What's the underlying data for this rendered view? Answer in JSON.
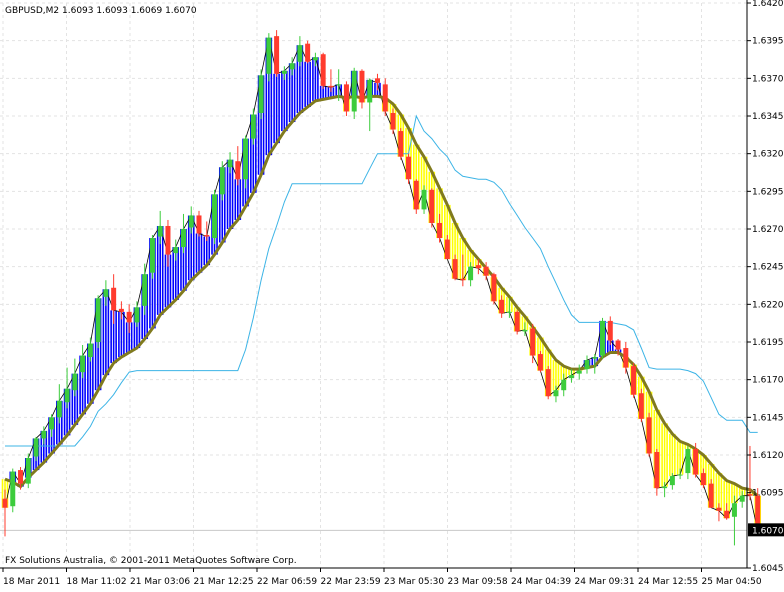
{
  "colors": {
    "background": "#ffffff",
    "grid": "#e3e3e3",
    "bull_candle": "#3ccc3c",
    "bear_candle": "#ff3b2e",
    "up_fill": "#0000ff",
    "down_fill": "#ffff00",
    "smooth_ma": "#807a1e",
    "channel_line": "#3cb4e6",
    "price_line": "#000000",
    "current_price_line": "#c8c8c8"
  },
  "chart_data": {
    "type": "line",
    "title": "GBPUSD,M2  1.6093 1.6093 1.6069 1.6070",
    "footer": "FX Solutions Australia, © 2001-2011 MetaQuotes Software Corp.",
    "current_price": 1.607,
    "current_price_label": "1.6070",
    "ylim": [
      1.6045,
      1.642
    ],
    "y_ticks": [
      "1.6420",
      "1.6395",
      "1.6370",
      "1.6345",
      "1.6320",
      "1.6295",
      "1.6270",
      "1.6245",
      "1.6220",
      "1.6195",
      "1.6170",
      "1.6145",
      "1.6120",
      "1.6095",
      "1.6045"
    ],
    "x_labels": [
      "18 Mar 2011",
      "18 Mar 11:02",
      "21 Mar 03:06",
      "21 Mar 12:25",
      "22 Mar 06:59",
      "22 Mar 23:59",
      "23 Mar 05:30",
      "23 Mar 09:58",
      "24 Mar 04:39",
      "24 Mar 09:31",
      "24 Mar 12:55",
      "25 Mar 04:50"
    ],
    "candles": {
      "o": [
        1.6091,
        1.6086,
        1.611,
        1.6101,
        1.6119,
        1.6131,
        1.6137,
        1.6145,
        1.6155,
        1.6163,
        1.6175,
        1.6185,
        1.6195,
        1.6225,
        1.6231,
        1.6217,
        1.6215,
        1.6208,
        1.6219,
        1.6241,
        1.6265,
        1.6272,
        1.6254,
        1.6258,
        1.6271,
        1.6279,
        1.6266,
        1.6264,
        1.6293,
        1.6311,
        1.6315,
        1.6303,
        1.633,
        1.6347,
        1.6373,
        1.6398,
        1.6373,
        1.6376,
        1.6381,
        1.6393,
        1.6382,
        1.6386,
        1.6365,
        1.6366,
        1.6366,
        1.6348,
        1.6375,
        1.6354,
        1.637,
        1.6366,
        1.6347,
        1.6335,
        1.6318,
        1.6302,
        1.6283,
        1.6296,
        1.6274,
        1.6263,
        1.625,
        1.6237,
        1.6236,
        1.6246,
        1.6245,
        1.624,
        1.6223,
        1.6215,
        1.6215,
        1.6202,
        1.6204,
        1.6187,
        1.6177,
        1.6159,
        1.6163,
        1.6171,
        1.6174,
        1.6177,
        1.6184,
        1.6186,
        1.6209,
        1.6196,
        1.6191,
        1.6179,
        1.6161,
        1.6145,
        1.6122,
        1.6098,
        1.61,
        1.6107,
        1.6108,
        1.6124,
        1.6108,
        1.6101,
        1.6085,
        1.6083,
        1.6079,
        1.6089,
        1.6094,
        1.6093
      ],
      "h": [
        1.6097,
        1.6111,
        1.6112,
        1.6121,
        1.6132,
        1.6139,
        1.6147,
        1.6167,
        1.6178,
        1.6184,
        1.6193,
        1.6198,
        1.6226,
        1.6236,
        1.624,
        1.6222,
        1.622,
        1.6222,
        1.6247,
        1.6266,
        1.6282,
        1.6276,
        1.6263,
        1.628,
        1.6285,
        1.6282,
        1.6275,
        1.6296,
        1.6315,
        1.6321,
        1.6325,
        1.6332,
        1.635,
        1.6376,
        1.64,
        1.6402,
        1.6378,
        1.6384,
        1.6398,
        1.6395,
        1.6387,
        1.6387,
        1.6376,
        1.6376,
        1.6368,
        1.6377,
        1.6376,
        1.637,
        1.6373,
        1.637,
        1.635,
        1.6337,
        1.632,
        1.6303,
        1.6299,
        1.6297,
        1.628,
        1.6266,
        1.6253,
        1.6253,
        1.6248,
        1.625,
        1.6248,
        1.6241,
        1.6226,
        1.6224,
        1.6216,
        1.6208,
        1.6207,
        1.6189,
        1.6179,
        1.6166,
        1.6174,
        1.6177,
        1.618,
        1.6186,
        1.6187,
        1.6211,
        1.6212,
        1.6197,
        1.6195,
        1.6181,
        1.6164,
        1.6148,
        1.6124,
        1.6102,
        1.6108,
        1.6111,
        1.6126,
        1.6128,
        1.6111,
        1.6104,
        1.6088,
        1.6088,
        1.6093,
        1.6096,
        1.6126,
        1.6098
      ],
      "l": [
        1.6066,
        1.6082,
        1.6097,
        1.6098,
        1.6116,
        1.6127,
        1.6132,
        1.6141,
        1.6151,
        1.6159,
        1.6171,
        1.6182,
        1.6191,
        1.6219,
        1.6207,
        1.621,
        1.6201,
        1.6205,
        1.6213,
        1.6237,
        1.626,
        1.6245,
        1.6249,
        1.6254,
        1.6267,
        1.6265,
        1.6262,
        1.626,
        1.6289,
        1.6307,
        1.6299,
        1.6297,
        1.6326,
        1.6343,
        1.6368,
        1.6371,
        1.6369,
        1.6372,
        1.6378,
        1.638,
        1.6378,
        1.6363,
        1.6361,
        1.6355,
        1.6345,
        1.6343,
        1.635,
        1.6335,
        1.6362,
        1.6345,
        1.6333,
        1.6316,
        1.63,
        1.628,
        1.628,
        1.6271,
        1.6261,
        1.625,
        1.6236,
        1.6232,
        1.6232,
        1.624,
        1.6236,
        1.622,
        1.6211,
        1.6211,
        1.62,
        1.6199,
        1.6181,
        1.6175,
        1.6157,
        1.6155,
        1.6159,
        1.6168,
        1.617,
        1.6174,
        1.6174,
        1.6184,
        1.6193,
        1.6186,
        1.6174,
        1.6158,
        1.6142,
        1.6119,
        1.6093,
        1.6092,
        1.6097,
        1.6104,
        1.6104,
        1.6105,
        1.6098,
        1.6085,
        1.6076,
        1.6077,
        1.606,
        1.6085,
        1.609,
        1.6069
      ],
      "c": [
        1.6085,
        1.6109,
        1.6101,
        1.6118,
        1.6131,
        1.6136,
        1.6145,
        1.6156,
        1.6164,
        1.6174,
        1.6186,
        1.6194,
        1.6224,
        1.623,
        1.6216,
        1.6215,
        1.6208,
        1.6218,
        1.624,
        1.6264,
        1.6272,
        1.6253,
        1.6258,
        1.627,
        1.6279,
        1.6267,
        1.6265,
        1.6293,
        1.6311,
        1.6316,
        1.6303,
        1.633,
        1.6346,
        1.6372,
        1.6397,
        1.6373,
        1.6375,
        1.638,
        1.6392,
        1.6381,
        1.6384,
        1.6365,
        1.6364,
        1.6366,
        1.6348,
        1.6375,
        1.6354,
        1.6369,
        1.6367,
        1.6348,
        1.6336,
        1.6318,
        1.6303,
        1.6283,
        1.6296,
        1.6274,
        1.6264,
        1.625,
        1.6237,
        1.6236,
        1.6245,
        1.6244,
        1.6239,
        1.6222,
        1.6214,
        1.6215,
        1.6202,
        1.6203,
        1.6186,
        1.6176,
        1.6159,
        1.6163,
        1.617,
        1.6173,
        1.6176,
        1.6183,
        1.6185,
        1.6209,
        1.6196,
        1.619,
        1.6178,
        1.616,
        1.6144,
        1.6121,
        1.6098,
        1.6099,
        1.6106,
        1.6107,
        1.6124,
        1.6107,
        1.61,
        1.6085,
        1.6083,
        1.6078,
        1.6088,
        1.6093,
        1.6093,
        1.607
      ]
    },
    "indicator": {
      "smooth_ma": [
        1.6104,
        1.6102,
        1.6099,
        1.6105,
        1.611,
        1.6115,
        1.6121,
        1.6127,
        1.6133,
        1.614,
        1.6147,
        1.6154,
        1.6163,
        1.6173,
        1.6181,
        1.6185,
        1.6188,
        1.6191,
        1.6197,
        1.6204,
        1.6213,
        1.6218,
        1.6223,
        1.6229,
        1.6236,
        1.6241,
        1.6246,
        1.6253,
        1.6261,
        1.627,
        1.6276,
        1.6285,
        1.6294,
        1.6306,
        1.6319,
        1.6327,
        1.6335,
        1.6341,
        1.6347,
        1.6351,
        1.6355,
        1.6356,
        1.6357,
        1.6358,
        1.6357,
        1.6358,
        1.6357,
        1.6358,
        1.6358,
        1.6357,
        1.6353,
        1.6346,
        1.6337,
        1.6326,
        1.6318,
        1.6308,
        1.6297,
        1.6286,
        1.6274,
        1.6264,
        1.6256,
        1.625,
        1.6244,
        1.6238,
        1.6231,
        1.6225,
        1.6218,
        1.6212,
        1.6205,
        1.6198,
        1.619,
        1.6183,
        1.6179,
        1.6177,
        1.6177,
        1.6178,
        1.6179,
        1.6185,
        1.6188,
        1.6188,
        1.6185,
        1.618,
        1.6172,
        1.6162,
        1.615,
        1.6141,
        1.6134,
        1.6129,
        1.6127,
        1.6124,
        1.612,
        1.6114,
        1.6108,
        1.6103,
        1.6101,
        1.6098,
        1.6097,
        1.6093
      ],
      "channel": [
        1.6126,
        1.6126,
        1.6126,
        1.6126,
        1.6126,
        1.6126,
        1.6126,
        1.6126,
        1.6126,
        1.6126,
        1.6132,
        1.6139,
        1.6149,
        1.6154,
        1.616,
        1.6168,
        1.6175,
        1.6176,
        1.6176,
        1.6176,
        1.6176,
        1.6176,
        1.6176,
        1.6176,
        1.6176,
        1.6176,
        1.6176,
        1.6176,
        1.6176,
        1.6176,
        1.6176,
        1.619,
        1.6211,
        1.6236,
        1.6257,
        1.6272,
        1.6288,
        1.63,
        1.63,
        1.63,
        1.63,
        1.63,
        1.63,
        1.63,
        1.63,
        1.63,
        1.63,
        1.631,
        1.632,
        1.632,
        1.632,
        1.632,
        1.632,
        1.6345,
        1.6335,
        1.633,
        1.6323,
        1.6318,
        1.6309,
        1.6305,
        1.6304,
        1.6303,
        1.6303,
        1.6301,
        1.6296,
        1.6287,
        1.6279,
        1.6271,
        1.6264,
        1.6257,
        1.6245,
        1.6234,
        1.6223,
        1.6213,
        1.6208,
        1.6208,
        1.6208,
        1.6208,
        1.6208,
        1.6207,
        1.6206,
        1.6203,
        1.6191,
        1.6178,
        1.6177,
        1.6177,
        1.6177,
        1.6177,
        1.6176,
        1.6174,
        1.6169,
        1.6158,
        1.6147,
        1.6143,
        1.6143,
        1.6143,
        1.6135,
        1.6135
      ]
    }
  }
}
